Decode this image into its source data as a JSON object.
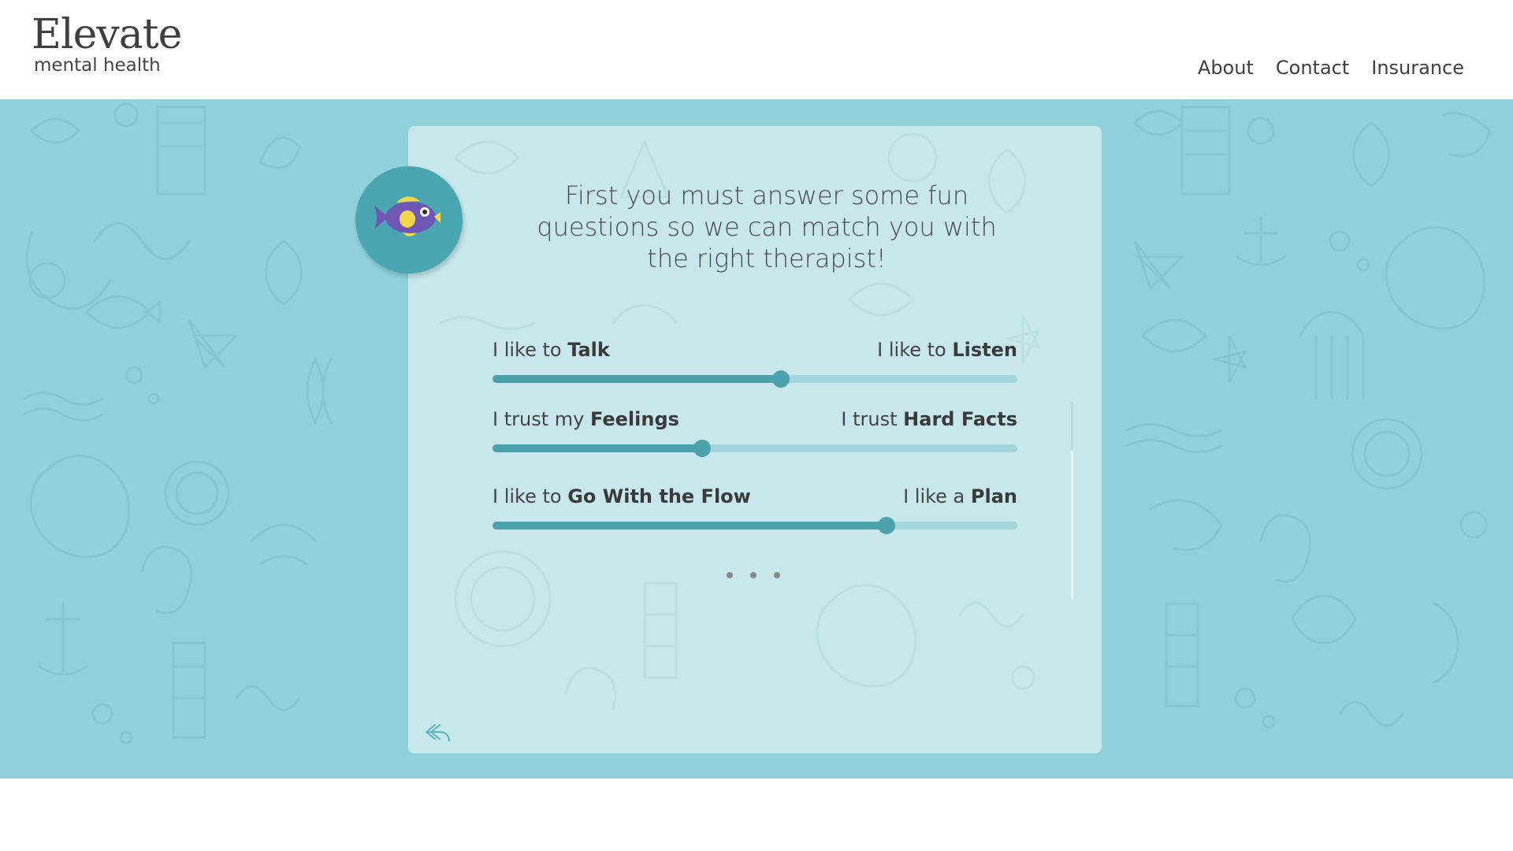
{
  "brand": {
    "name": "Elevate",
    "tagline": "mental health"
  },
  "nav": {
    "items": [
      "About",
      "Contact",
      "Insurance"
    ]
  },
  "card": {
    "question": "First you must answer some fun questions so we can match you with the right therapist!",
    "sliders": [
      {
        "left_prefix": "I like to ",
        "left_bold": "Talk",
        "right_prefix": "I like to ",
        "right_bold": "Listen",
        "value": 0.55
      },
      {
        "left_prefix": "I trust my ",
        "left_bold": "Feelings",
        "right_prefix": "I trust ",
        "right_bold": "Hard Facts",
        "value": 0.4
      },
      {
        "left_prefix": "I like to ",
        "left_bold": "Go With the Flow",
        "right_prefix": "I like a ",
        "right_bold": "Plan",
        "value": 0.75
      }
    ],
    "avatar_icon": "fish-icon",
    "back_icon": "reply-arrow-icon"
  },
  "colors": {
    "background": "#8fd0da",
    "card": "#c7e7ec",
    "accent": "#4ba1ac",
    "track": "#a3d5dc",
    "avatar": "#4aa6b1"
  }
}
